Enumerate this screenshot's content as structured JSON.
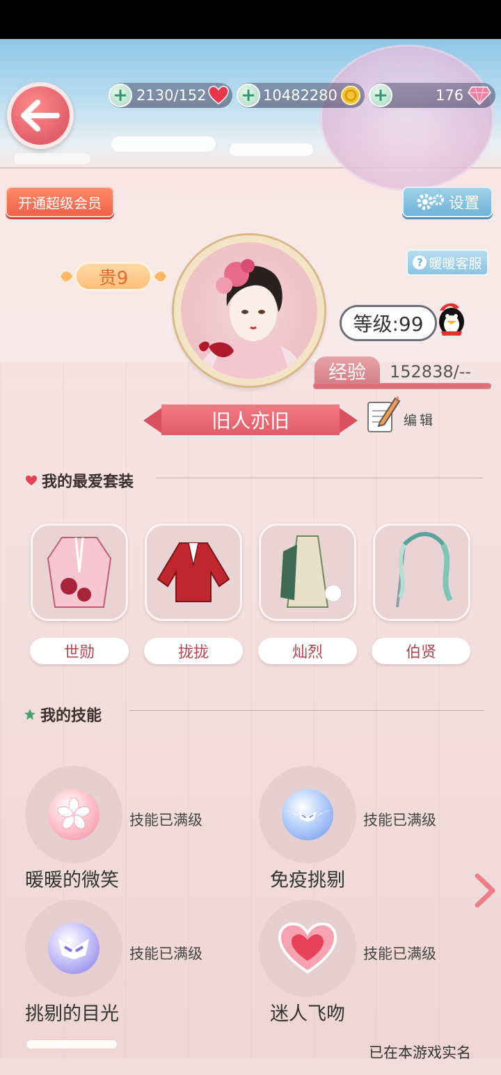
{
  "resources": {
    "stamina": "2130/152",
    "coins": "10482280",
    "diamonds": "176"
  },
  "buttons": {
    "vip": "开通超级会员",
    "settings": "设置",
    "service": "暖暖客服",
    "edit": "编辑"
  },
  "profile": {
    "vip_rank": "贵9",
    "level": "等级:99",
    "exp_label": "经验",
    "exp_value": "152838/--",
    "exp_progress": 1.0,
    "name": "旧人亦旧"
  },
  "favorites": {
    "title": "我的最爱套装",
    "items": [
      {
        "label": "世勋"
      },
      {
        "label": "拢拢"
      },
      {
        "label": "灿烈"
      },
      {
        "label": "伯贤"
      }
    ]
  },
  "skills": {
    "title": "我的技能",
    "items": [
      {
        "name": "暖暖的微笑",
        "status": "技能已满级",
        "icon": "sakura-icon"
      },
      {
        "name": "免疫挑剔",
        "status": "技能已满级",
        "icon": "winged-mask-icon"
      },
      {
        "name": "挑剔的目光",
        "status": "技能已满级",
        "icon": "mask-icon"
      },
      {
        "name": "迷人飞吻",
        "status": "技能已满级",
        "icon": "heart-icon"
      }
    ]
  },
  "footer": {
    "realname": "已在本游戏实名"
  },
  "colors": {
    "accent": "#e05d69",
    "vip_button": "#f0624a",
    "settings_button": "#6fb4d8"
  }
}
